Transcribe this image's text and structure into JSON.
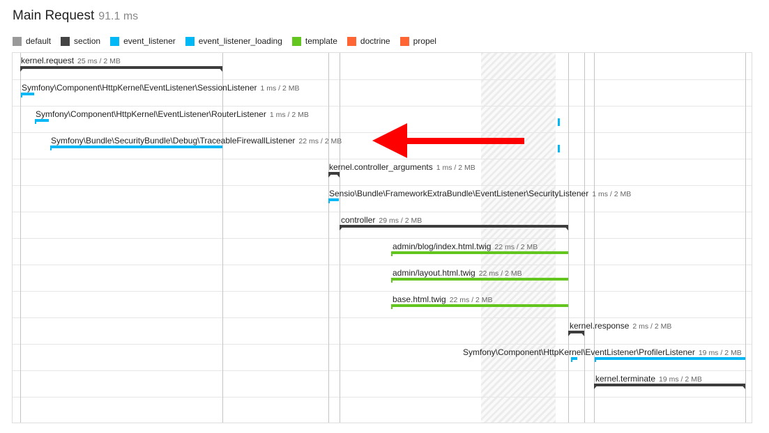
{
  "header": {
    "title": "Main Request",
    "duration": "91.1 ms"
  },
  "legend": [
    {
      "label": "default",
      "color": "#999999"
    },
    {
      "label": "section",
      "color": "#444444"
    },
    {
      "label": "event_listener",
      "color": "#00b8f5"
    },
    {
      "label": "event_listener_loading",
      "color": "#00b8f5"
    },
    {
      "label": "template",
      "color": "#62c61f"
    },
    {
      "label": "doctrine",
      "color": "#ff6633"
    },
    {
      "label": "propel",
      "color": "#ff6633"
    }
  ],
  "events": [
    {
      "name": "kernel.request",
      "meta": "25 ms / 2 MB",
      "category": "section"
    },
    {
      "name": "Symfony\\Component\\HttpKernel\\EventListener\\SessionListener",
      "meta": "1 ms / 2 MB",
      "category": "event_listener"
    },
    {
      "name": "Symfony\\Component\\HttpKernel\\EventListener\\RouterListener",
      "meta": "1 ms / 2 MB",
      "category": "event_listener"
    },
    {
      "name": "Symfony\\Bundle\\SecurityBundle\\Debug\\TraceableFirewallListener",
      "meta": "22 ms / 2 MB",
      "category": "event_listener"
    },
    {
      "name": "kernel.controller_arguments",
      "meta": "1 ms / 2 MB",
      "category": "section"
    },
    {
      "name": "Sensio\\Bundle\\FrameworkExtraBundle\\EventListener\\SecurityListener",
      "meta": "1 ms / 2 MB",
      "category": "event_listener"
    },
    {
      "name": "controller",
      "meta": "29 ms / 2 MB",
      "category": "section"
    },
    {
      "name": "admin/blog/index.html.twig",
      "meta": "22 ms / 2 MB",
      "category": "template"
    },
    {
      "name": "admin/layout.html.twig",
      "meta": "22 ms / 2 MB",
      "category": "template"
    },
    {
      "name": "base.html.twig",
      "meta": "22 ms / 2 MB",
      "category": "template"
    },
    {
      "name": "kernel.response",
      "meta": "2 ms / 2 MB",
      "category": "section"
    },
    {
      "name": "Symfony\\Component\\HttpKernel\\EventListener\\ProfilerListener",
      "meta": "19 ms / 2 MB",
      "category": "event_listener"
    },
    {
      "name": "kernel.terminate",
      "meta": "19 ms / 2 MB",
      "category": "section"
    }
  ],
  "annotation": {
    "color": "#ff0000"
  }
}
